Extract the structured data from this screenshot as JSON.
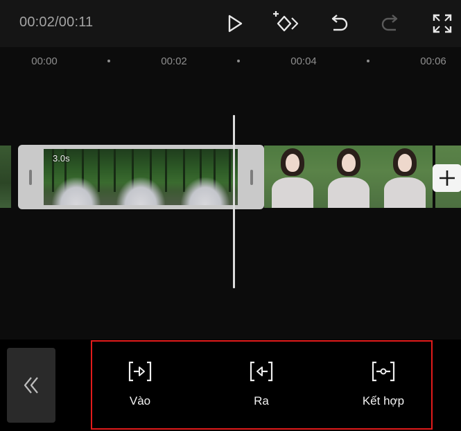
{
  "header": {
    "timecode": "00:02/00:11",
    "icons": [
      "play-icon",
      "keyframe-icon",
      "undo-icon",
      "redo-icon",
      "fullscreen-icon"
    ]
  },
  "ruler": {
    "labels": [
      "00:00",
      "00:02",
      "00:04",
      "00:06"
    ]
  },
  "timeline": {
    "selected_clip_duration": "3.0s"
  },
  "toolbar": {
    "back_icon": "double-chevron-left-icon",
    "tools": [
      {
        "label": "Vào",
        "icon": "trim-in-icon"
      },
      {
        "label": "Ra",
        "icon": "trim-out-icon"
      },
      {
        "label": "Kết hợp",
        "icon": "combine-icon"
      }
    ]
  },
  "colors": {
    "highlight": "#e21b1b",
    "background": "#121212"
  }
}
